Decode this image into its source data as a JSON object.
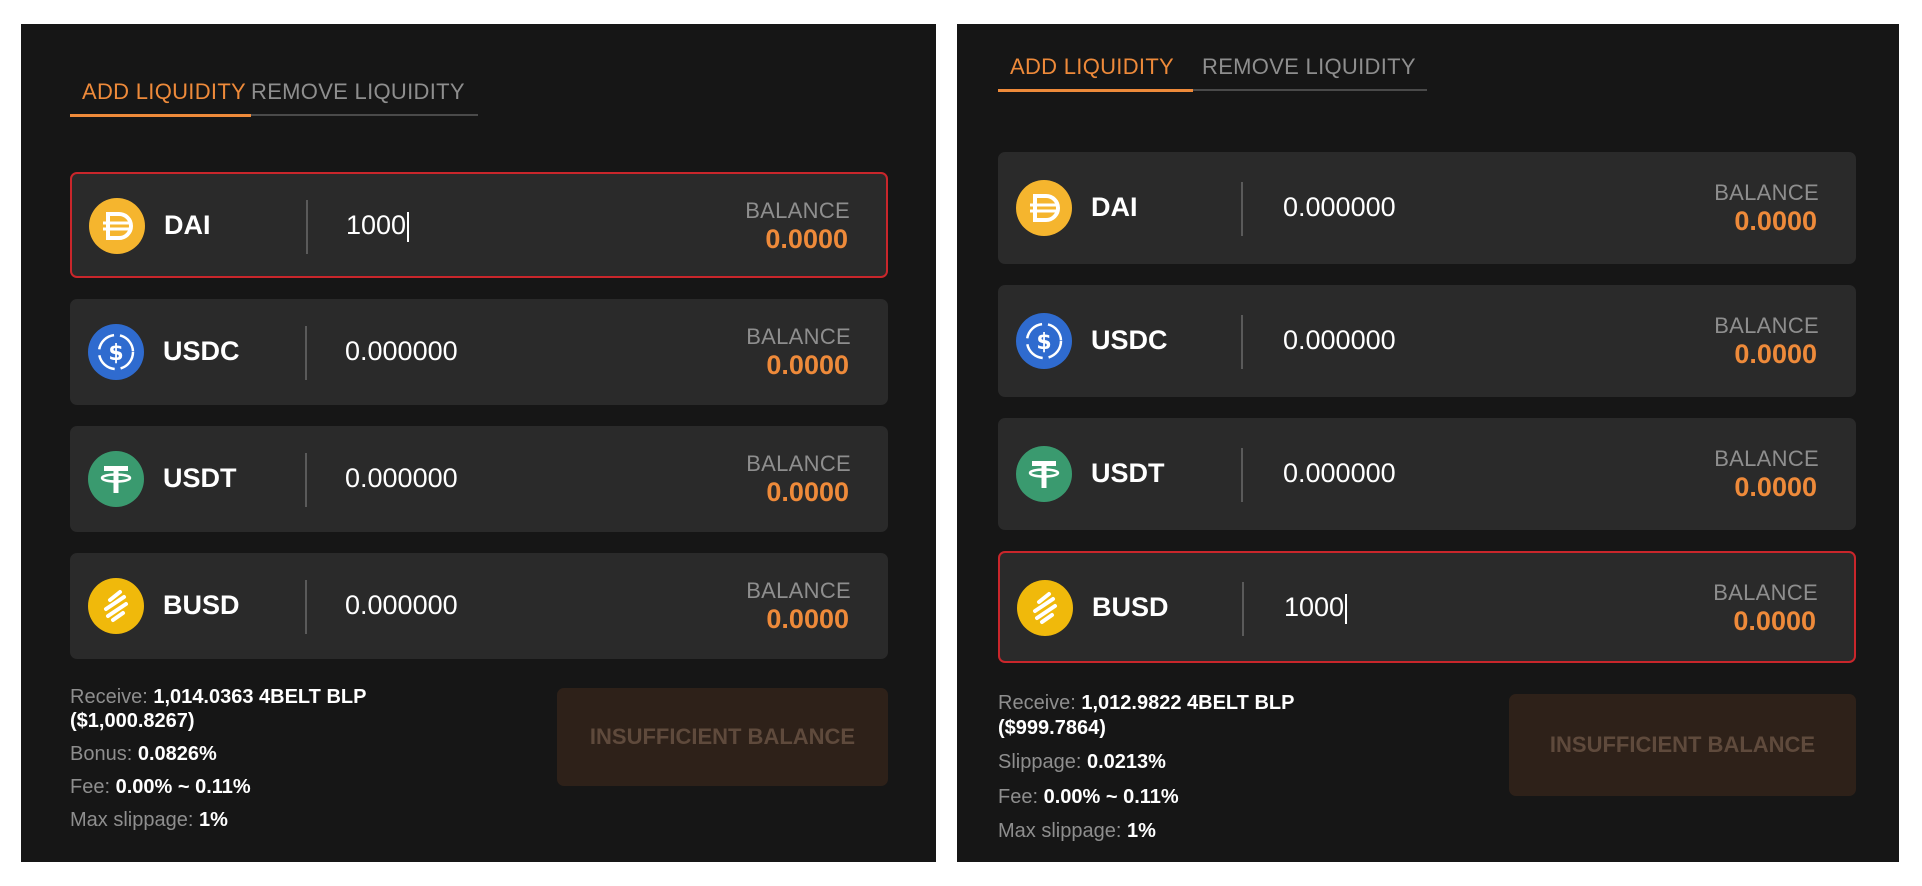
{
  "colors": {
    "accent": "#ee8a3a",
    "error_border": "#c9262b",
    "panel_bg": "#161616",
    "row_bg": "#2a2a2a"
  },
  "left": {
    "tabs": {
      "add": "ADD LIQUIDITY",
      "remove": "REMOVE LIQUIDITY"
    },
    "tokens": [
      {
        "name": "DAI",
        "amount": "1000",
        "balance_label": "BALANCE",
        "balance": "0.0000",
        "icon": "dai-icon"
      },
      {
        "name": "USDC",
        "amount": "0.000000",
        "balance_label": "BALANCE",
        "balance": "0.0000",
        "icon": "usdc-icon"
      },
      {
        "name": "USDT",
        "amount": "0.000000",
        "balance_label": "BALANCE",
        "balance": "0.0000",
        "icon": "usdt-icon"
      },
      {
        "name": "BUSD",
        "amount": "0.000000",
        "balance_label": "BALANCE",
        "balance": "0.0000",
        "icon": "busd-icon"
      }
    ],
    "info": {
      "receive_label": "Receive:",
      "receive_value": "1,014.0363 4BELT BLP",
      "receive_usd": "($1,000.8267)",
      "bonus_label": "Bonus:",
      "bonus_value": "0.0826%",
      "fee_label": "Fee:",
      "fee_value": "0.00% ~ 0.11%",
      "max_slippage_label": "Max slippage:",
      "max_slippage_value": "1%"
    },
    "button": "INSUFFICIENT BALANCE"
  },
  "right": {
    "tabs": {
      "add": "ADD LIQUIDITY",
      "remove": "REMOVE LIQUIDITY"
    },
    "tokens": [
      {
        "name": "DAI",
        "amount": "0.000000",
        "balance_label": "BALANCE",
        "balance": "0.0000",
        "icon": "dai-icon"
      },
      {
        "name": "USDC",
        "amount": "0.000000",
        "balance_label": "BALANCE",
        "balance": "0.0000",
        "icon": "usdc-icon"
      },
      {
        "name": "USDT",
        "amount": "0.000000",
        "balance_label": "BALANCE",
        "balance": "0.0000",
        "icon": "usdt-icon"
      },
      {
        "name": "BUSD",
        "amount": "1000",
        "balance_label": "BALANCE",
        "balance": "0.0000",
        "icon": "busd-icon"
      }
    ],
    "info": {
      "receive_label": "Receive:",
      "receive_value": "1,012.9822 4BELT BLP",
      "receive_usd": "($999.7864)",
      "slippage_label": "Slippage:",
      "slippage_value": "0.0213%",
      "fee_label": "Fee:",
      "fee_value": "0.00% ~ 0.11%",
      "max_slippage_label": "Max slippage:",
      "max_slippage_value": "1%"
    },
    "button": "INSUFFICIENT BALANCE"
  }
}
